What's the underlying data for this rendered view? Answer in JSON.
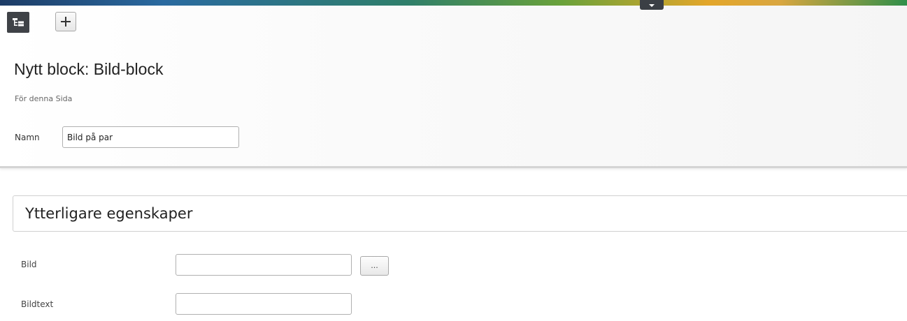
{
  "toolbar": {
    "tree_icon": "navigation-tree-icon",
    "add_icon": "plus-icon",
    "collapse_icon": "chevron-down-icon"
  },
  "header": {
    "title": "Nytt block: Bild-block",
    "subtitle": "För denna Sida",
    "name_label": "Namn",
    "name_value": "Bild på par"
  },
  "section": {
    "title": "Ytterligare egenskaper"
  },
  "fields": {
    "image_label": "Bild",
    "image_value": "",
    "browse_label": "...",
    "caption_label": "Bildtext",
    "caption_value": ""
  },
  "colors": {
    "dark_button": "#3f4247",
    "border": "#b0b0b0",
    "gradient": [
      "#1d3c66",
      "#2a6aa0",
      "#6aa23a",
      "#e3a62a",
      "#2f8f4a"
    ]
  }
}
